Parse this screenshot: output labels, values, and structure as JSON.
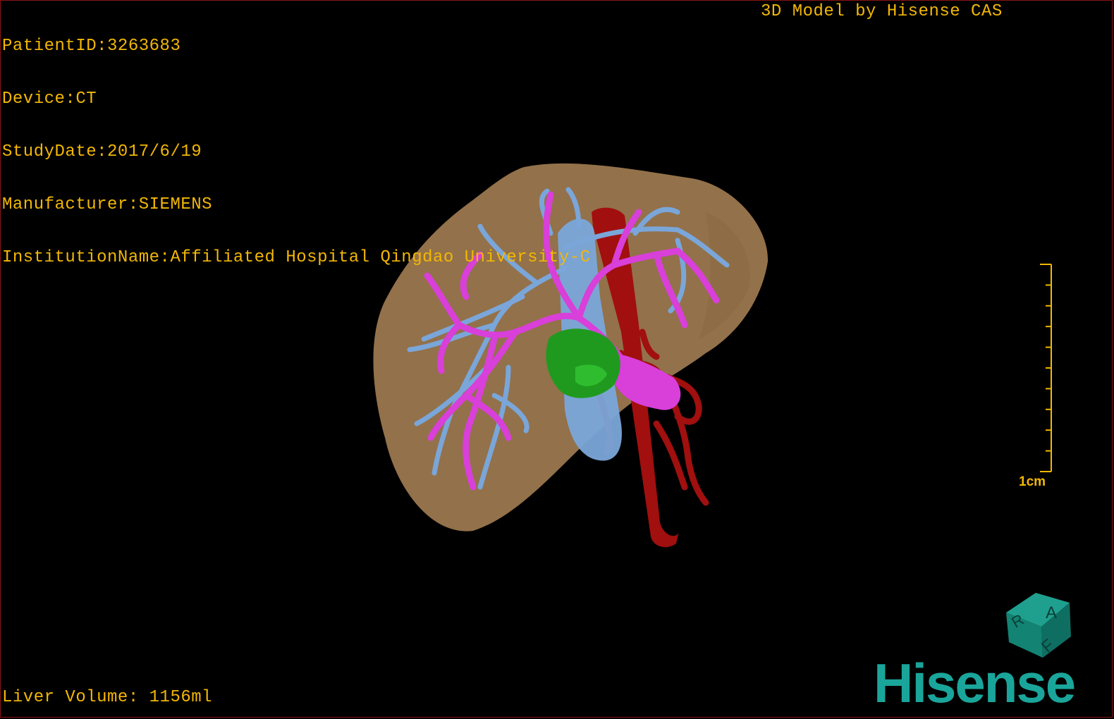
{
  "study_info": {
    "lines": [
      "PatientID:3263683",
      "Device:CT",
      "StudyDate:2017/6/19",
      "Manufacturer:SIEMENS",
      "InstitutionName:Affiliated Hospital Qingdao University-C"
    ]
  },
  "credit": "3D Model by Hisense CAS",
  "liver_volume": "Liver Volume: 1156ml",
  "scale": {
    "label": "1cm",
    "ticks": 10
  },
  "orientation_cube": {
    "labels": [
      "R",
      "A",
      "F"
    ]
  },
  "brand": "Hisense",
  "colors": {
    "overlay_text": "#f2b705",
    "liver": "#a07b50",
    "portal_vein": "#d93fd9",
    "hepatic_vein": "#7aa6d9",
    "artery_ivc": "#a10f0f",
    "tumor": "#1f9a1f",
    "brand": "#1aa59a"
  },
  "structures": [
    "liver",
    "portal-vein",
    "hepatic-vein",
    "inferior-vena-cava",
    "hepatic-artery",
    "tumor"
  ]
}
